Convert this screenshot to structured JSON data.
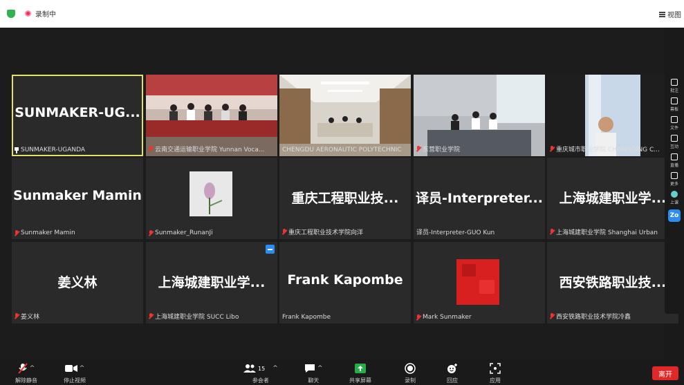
{
  "topbar": {
    "recording_label": "录制中",
    "view_label": "视图"
  },
  "tiles": [
    {
      "id": "sunmaker-uganda",
      "display_name": "SUNMAKER-UG...",
      "label": "SUNMAKER-UGANDA",
      "pinned": true,
      "active": true
    },
    {
      "id": "yunnan",
      "label": "云南交通运输职业学院 Yunnan Voca...",
      "video": "classroom-group"
    },
    {
      "id": "chengdu",
      "label": "CHENGDU AERONAUTIC POLYTECHNIC",
      "video": "conference-room"
    },
    {
      "id": "dongguan",
      "label": "东营职业学院",
      "video": "office-meeting"
    },
    {
      "id": "chongqing-city",
      "label": "重庆城市职业学院 CHONGQING C...",
      "video": "single-person"
    },
    {
      "id": "sunmaker-mamin",
      "display_name": "Sunmaker Mamin",
      "label": "Sunmaker Mamin"
    },
    {
      "id": "runanji",
      "label": "Sunmaker_RunanJi",
      "video": "tulip-photo"
    },
    {
      "id": "chongqing-eng",
      "display_name": "重庆工程职业技...",
      "label": "重庆工程职业技术学院向洋"
    },
    {
      "id": "interpreter",
      "display_name": "译员-Interpreter...",
      "label": "译员-Interpreter-GUO Kun"
    },
    {
      "id": "shanghai-urban-1",
      "display_name": "上海城建职业学...",
      "label": "上海城建职业学院 Shanghai Urban"
    },
    {
      "id": "jiang-yilin",
      "display_name": "姜义林",
      "label": "姜义林"
    },
    {
      "id": "shanghai-urban-2",
      "display_name": "上海城建职业学...",
      "label": "上海城建职业学院 SUCC Libo"
    },
    {
      "id": "frank",
      "display_name": "Frank Kapombe",
      "label": "Frank Kapombe"
    },
    {
      "id": "mark",
      "label": "Mark Sunmaker",
      "video": "red-blur"
    },
    {
      "id": "xian-rail",
      "display_name": "西安铁路职业技...",
      "label": "西安铁路职业技术学院冷鑫"
    }
  ],
  "sidebar": {
    "items": [
      "批注",
      "幕板",
      "文件",
      "互动",
      "直播",
      "更多",
      "上课",
      "Zoom"
    ]
  },
  "toolbar": {
    "mute": "解除静音",
    "video": "停止视频",
    "participants_count": "15",
    "participants": "参会者",
    "chat": "聊天",
    "share": "共享屏幕",
    "record": "录制",
    "reactions": "回应",
    "apps": "应用",
    "end": "离开"
  },
  "colors": {
    "active_border": "#e3e36a",
    "end_button": "#e02828",
    "share_green": "#24b047",
    "accent_blue": "#2d8cf0"
  }
}
